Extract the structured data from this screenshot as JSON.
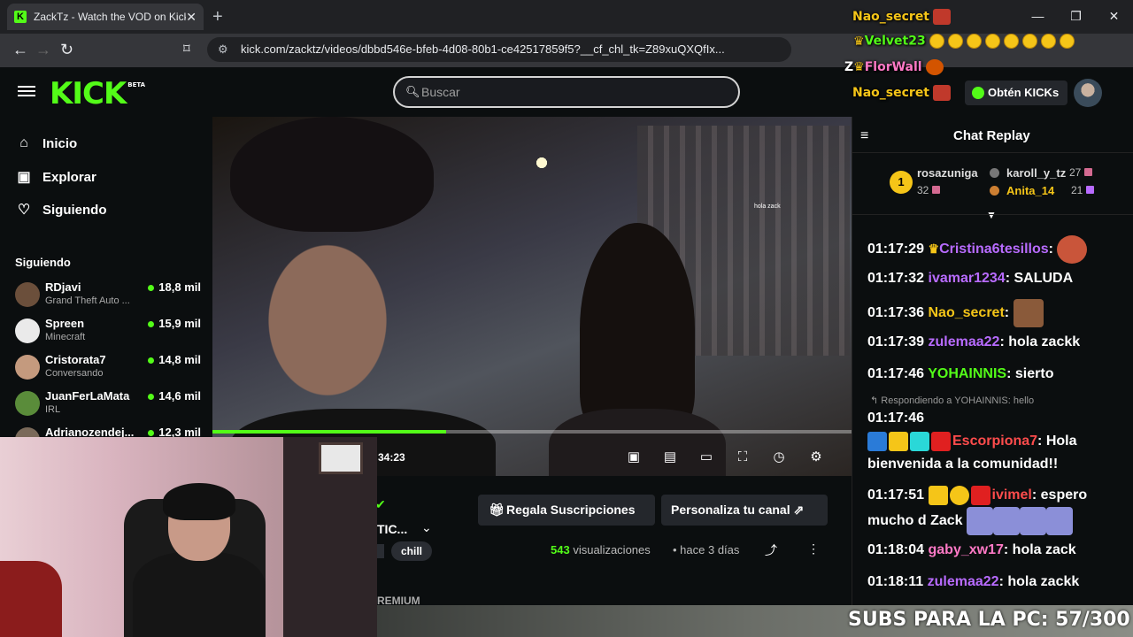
{
  "browser": {
    "tab_title": "ZackTz - Watch the VOD on Kick",
    "url": "kick.com/zacktz/videos/dbbd546e-bfeb-4d08-80b1-ce42517859f5?__cf_chl_tk=Z89xuQXQfIx..."
  },
  "header": {
    "logo": "KICK",
    "logo_badge": "BETA",
    "search_placeholder": "Buscar",
    "get_kicks": "Obtén KICKs"
  },
  "sidebar": {
    "nav": [
      {
        "label": "Inicio",
        "icon": "home-icon"
      },
      {
        "label": "Explorar",
        "icon": "browse-icon"
      },
      {
        "label": "Siguiendo",
        "icon": "heart-icon"
      }
    ],
    "following_title": "Siguiendo",
    "channels": [
      {
        "name": "RDjavi",
        "category": "Grand Theft Auto ...",
        "viewers": "18,8 mil"
      },
      {
        "name": "Spreen",
        "category": "Minecraft",
        "viewers": "15,9 mil"
      },
      {
        "name": "Cristorata7",
        "category": "Conversando",
        "viewers": "14,8 mil"
      },
      {
        "name": "JuanFerLaMata",
        "category": "IRL",
        "viewers": "14,6 mil"
      },
      {
        "name": "Adrianozendej...",
        "category": "",
        "viewers": "12,3 mil"
      }
    ]
  },
  "player": {
    "time": "34:23",
    "progress": 0.366,
    "overlay_text": "hola zack"
  },
  "video_info": {
    "gift_subs": "Regala Suscripciones",
    "customize_channel": "Personaliza tu canal",
    "title_truncated": "TIC...",
    "tag": "chill",
    "views_count": "543",
    "views_label": "visualizaciones",
    "ago": "hace 3 días",
    "premium": "REMIUM"
  },
  "chat": {
    "title": "Chat Replay",
    "top_gifters": [
      {
        "rank": "1",
        "name": "rosazuniga",
        "count": "32"
      },
      {
        "name": "karoll_y_tz",
        "count": "27"
      },
      {
        "name": "Anita_14",
        "count": "21"
      }
    ],
    "messages": [
      {
        "ts": "01:17:29",
        "user": "Cristina6tesillos",
        "text": ""
      },
      {
        "ts": "01:17:32",
        "user": "ivamar1234",
        "text": "SALUDA"
      },
      {
        "ts": "01:17:36",
        "user": "Nao_secret",
        "text": ""
      },
      {
        "ts": "01:17:39",
        "user": "zulemaa22",
        "text": "hola zackk"
      },
      {
        "ts": "01:17:46",
        "user": "YOHAINNIS",
        "text": "sierto"
      },
      {
        "ts": "01:17:46",
        "user": "Escorpiona7",
        "text": "Hola bienvenida a la comunidad!!",
        "reply": "Respondiendo a YOHAINNIS: hello"
      },
      {
        "ts": "01:17:51",
        "user": "ivimel",
        "text": "espero mucho d Zack"
      },
      {
        "ts": "01:18:04",
        "user": "gaby_xw17",
        "text": "hola zack"
      },
      {
        "ts": "01:18:11",
        "user": "zulemaa22",
        "text": "hola zackk"
      }
    ]
  },
  "stream_overlay": {
    "alerts": [
      "Nao_secret",
      "Velvet23",
      "FlorWall",
      "Nao_secret"
    ],
    "subs_goal": "SUBS PARA LA PC: 57/300"
  },
  "colors": {
    "kick_green": "#53fc18",
    "background": "#0b0e0f",
    "panel": "#24272c"
  }
}
